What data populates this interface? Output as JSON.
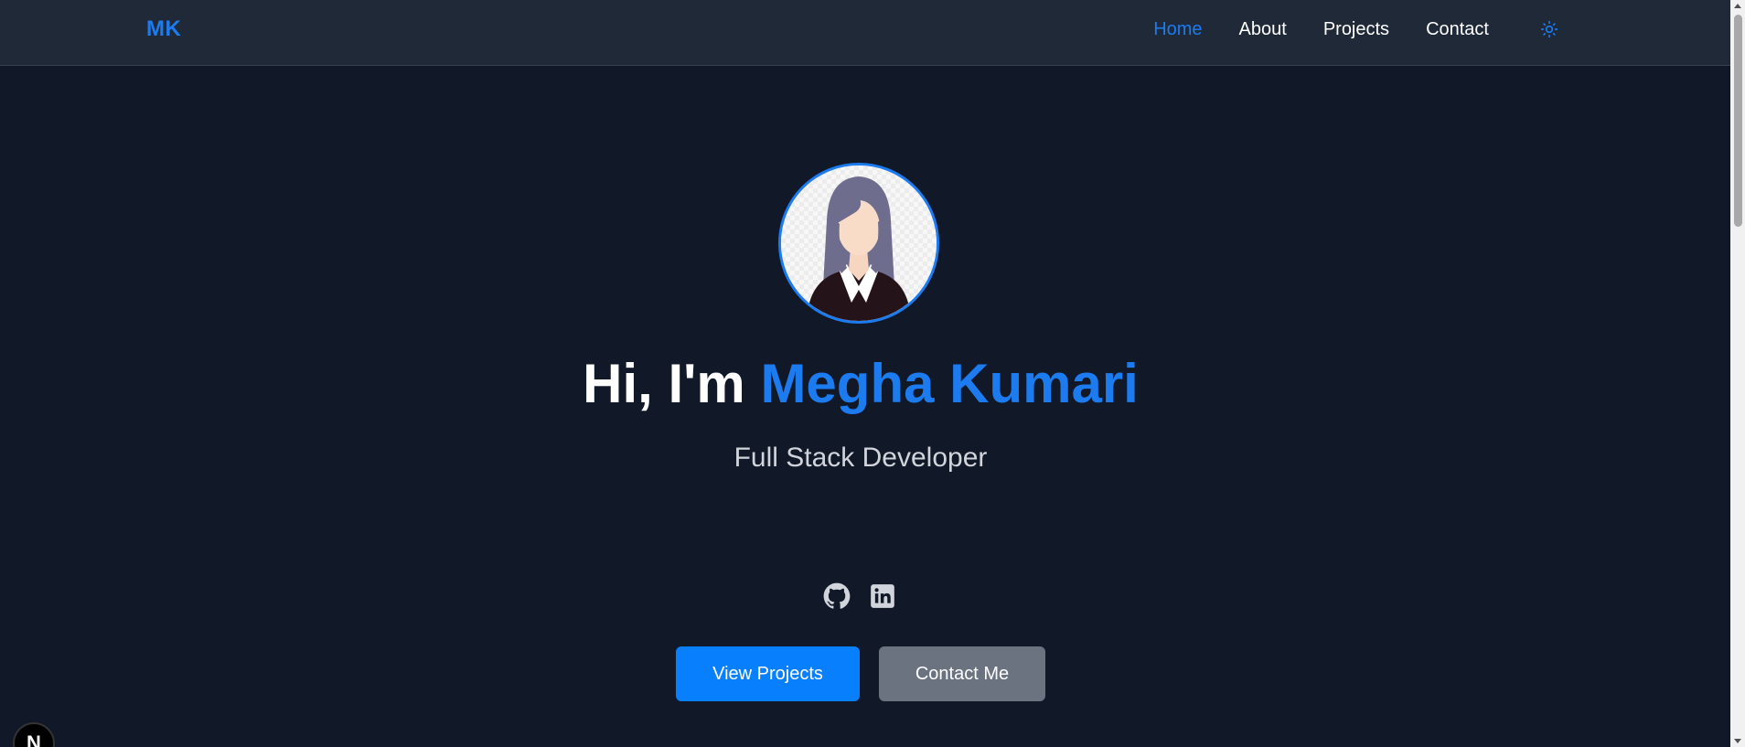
{
  "nav": {
    "logo": "MK",
    "links": [
      {
        "label": "Home",
        "active": true
      },
      {
        "label": "About",
        "active": false
      },
      {
        "label": "Projects",
        "active": false
      },
      {
        "label": "Contact",
        "active": false
      }
    ],
    "theme_icon": "sun-icon"
  },
  "hero": {
    "greeting": "Hi, I'm ",
    "name": "Megha Kumari",
    "subtitle": "Full Stack Developer",
    "socials": [
      {
        "icon": "github-icon"
      },
      {
        "icon": "linkedin-icon"
      }
    ],
    "primary_button": "View Projects",
    "secondary_button": "Contact Me"
  },
  "dev_indicator": {
    "label": "N"
  },
  "colors": {
    "background": "#111827",
    "navbar": "#1f2937",
    "accent": "#1d7bf0",
    "primary_button": "#087ffc",
    "secondary_button": "#6b7280",
    "subtitle": "#d1d5db"
  }
}
